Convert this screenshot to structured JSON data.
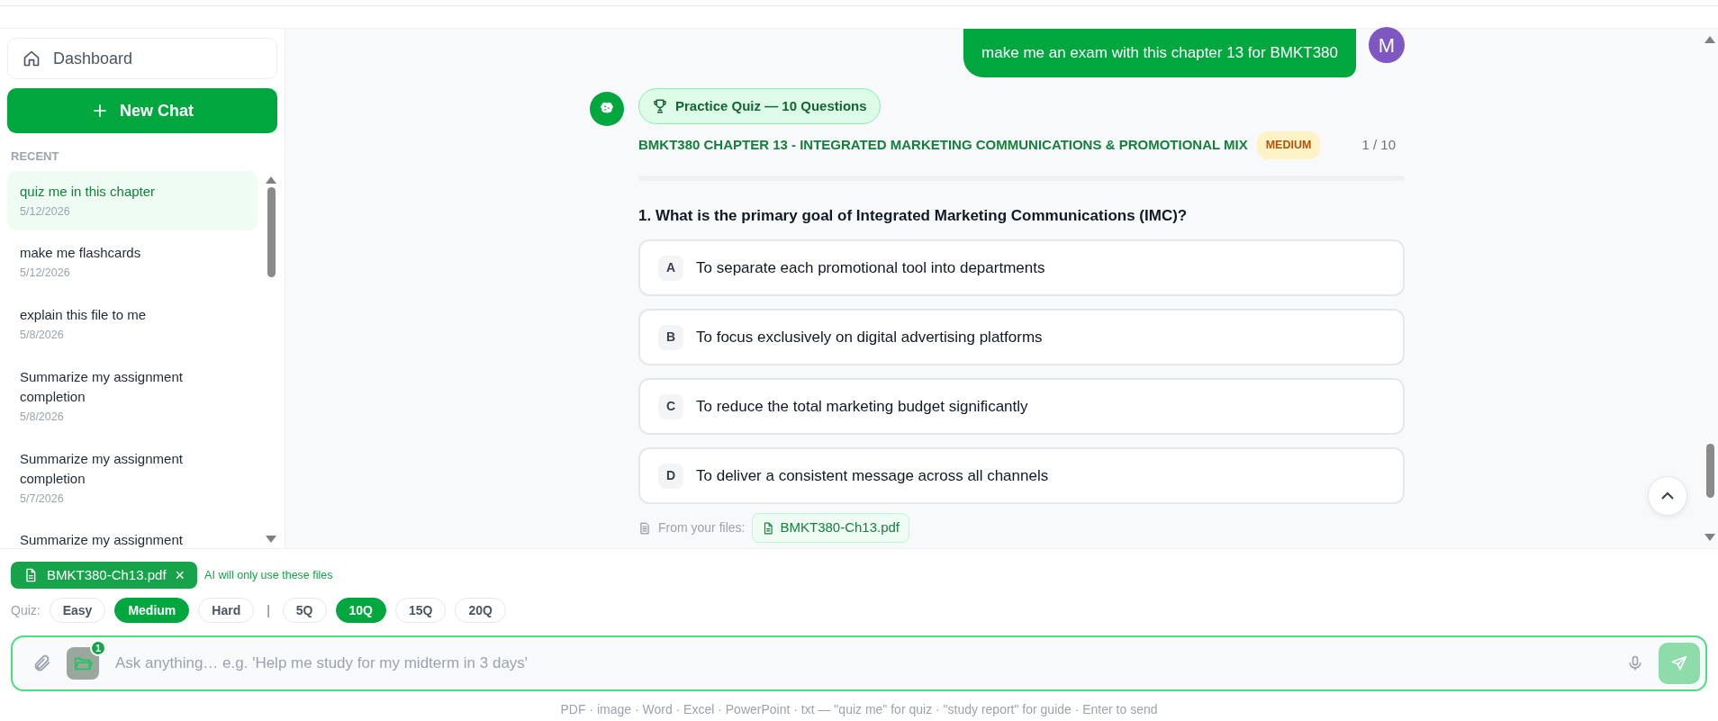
{
  "sidebar": {
    "dashboard": "Dashboard",
    "new_chat": "New Chat",
    "recent_label": "RECENT",
    "chats": [
      {
        "title": "quiz me in this chapter",
        "date": "5/12/2026",
        "selected": true
      },
      {
        "title": "make me flashcards",
        "date": "5/12/2026",
        "selected": false
      },
      {
        "title": "explain this file to me",
        "date": "5/8/2026",
        "selected": false
      },
      {
        "title": "Summarize my assignment completion",
        "date": "5/8/2026",
        "selected": false
      },
      {
        "title": "Summarize my assignment completion",
        "date": "5/7/2026",
        "selected": false
      },
      {
        "title": "Summarize my assignment",
        "selected": false
      }
    ]
  },
  "user_message": {
    "text": "make me an exam with this chapter 13 for BMKT380",
    "avatar": "M"
  },
  "quiz": {
    "badge": "Practice Quiz — 10 Questions",
    "title": "BMKT380 CHAPTER 13 - INTEGRATED MARKETING COMMUNICATIONS & PROMOTIONAL MIX",
    "difficulty": "MEDIUM",
    "counter": "1 / 10",
    "question": "1. What is the primary goal of Integrated Marketing Communications (IMC)?",
    "options": [
      {
        "letter": "A",
        "text": "To separate each promotional tool into departments"
      },
      {
        "letter": "B",
        "text": "To focus exclusively on digital advertising platforms"
      },
      {
        "letter": "C",
        "text": "To reduce the total marketing budget significantly"
      },
      {
        "letter": "D",
        "text": "To deliver a consistent message across all channels"
      }
    ],
    "source_label": "From your files:",
    "source_file": "BMKT380-Ch13.pdf"
  },
  "composer": {
    "attached_file": "BMKT380-Ch13.pdf",
    "remove": "×",
    "scope_note": "AI will only use these files",
    "quiz_label": "Quiz:",
    "difficulties": [
      {
        "label": "Easy",
        "selected": false
      },
      {
        "label": "Medium",
        "selected": true
      },
      {
        "label": "Hard",
        "selected": false
      }
    ],
    "separator": "|",
    "counts": [
      {
        "label": "5Q",
        "selected": false
      },
      {
        "label": "10Q",
        "selected": true
      },
      {
        "label": "15Q",
        "selected": false
      },
      {
        "label": "20Q",
        "selected": false
      }
    ],
    "folder_count": "1",
    "placeholder": "Ask anything… e.g. 'Help me study for my midterm in 3 days'",
    "footer": "PDF · image · Word · Excel · PowerPoint · txt — \"quiz me\" for quiz · \"study report\" for guide · Enter to send"
  }
}
